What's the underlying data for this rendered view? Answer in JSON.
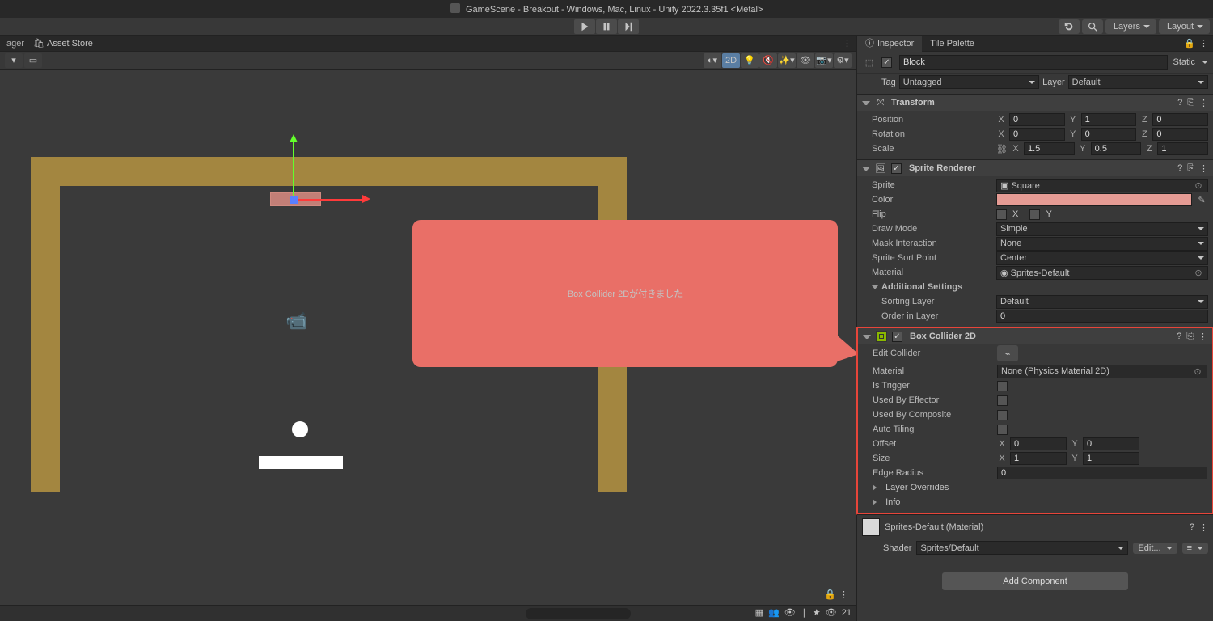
{
  "title": "GameScene - Breakout - Windows, Mac, Linux - Unity 2022.3.35f1 <Metal>",
  "top": {
    "layers": "Layers",
    "layout": "Layout"
  },
  "tabs": {
    "ager": "ager",
    "asset_store": "Asset Store",
    "inspector": "Inspector",
    "tile_palette": "Tile Palette"
  },
  "scene_toolbar": {
    "mode_2d": "2D"
  },
  "callout": "Box Collider 2Dが付きました",
  "scene_footer": {
    "count": "21"
  },
  "go": {
    "name": "Block",
    "static": "Static",
    "tag_label": "Tag",
    "tag_value": "Untagged",
    "layer_label": "Layer",
    "layer_value": "Default"
  },
  "transform": {
    "title": "Transform",
    "position": "Position",
    "px": "0",
    "py": "1",
    "pz": "0",
    "rotation": "Rotation",
    "rx": "0",
    "ry": "0",
    "rz": "0",
    "scale": "Scale",
    "sx": "1.5",
    "sy": "0.5",
    "sz": "1"
  },
  "sprite": {
    "title": "Sprite Renderer",
    "sprite": "Sprite",
    "sprite_val": "Square",
    "color": "Color",
    "flip": "Flip",
    "flip_x": "X",
    "flip_y": "Y",
    "draw_mode": "Draw Mode",
    "draw_mode_val": "Simple",
    "mask": "Mask Interaction",
    "mask_val": "None",
    "sort_point": "Sprite Sort Point",
    "sort_point_val": "Center",
    "material": "Material",
    "material_val": "Sprites-Default",
    "additional": "Additional Settings",
    "sort_layer": "Sorting Layer",
    "sort_layer_val": "Default",
    "order": "Order in Layer",
    "order_val": "0"
  },
  "box": {
    "title": "Box Collider 2D",
    "edit": "Edit Collider",
    "material": "Material",
    "material_val": "None (Physics Material 2D)",
    "is_trigger": "Is Trigger",
    "used_by_effector": "Used By Effector",
    "used_by_composite": "Used By Composite",
    "auto_tiling": "Auto Tiling",
    "offset": "Offset",
    "ox": "0",
    "oy": "0",
    "size": "Size",
    "szx": "1",
    "szy": "1",
    "edge": "Edge Radius",
    "edge_val": "0",
    "layer_overrides": "Layer Overrides",
    "info": "Info"
  },
  "material_section": {
    "name": "Sprites-Default (Material)",
    "shader_label": "Shader",
    "shader_val": "Sprites/Default",
    "edit": "Edit..."
  },
  "add_component": "Add Component"
}
